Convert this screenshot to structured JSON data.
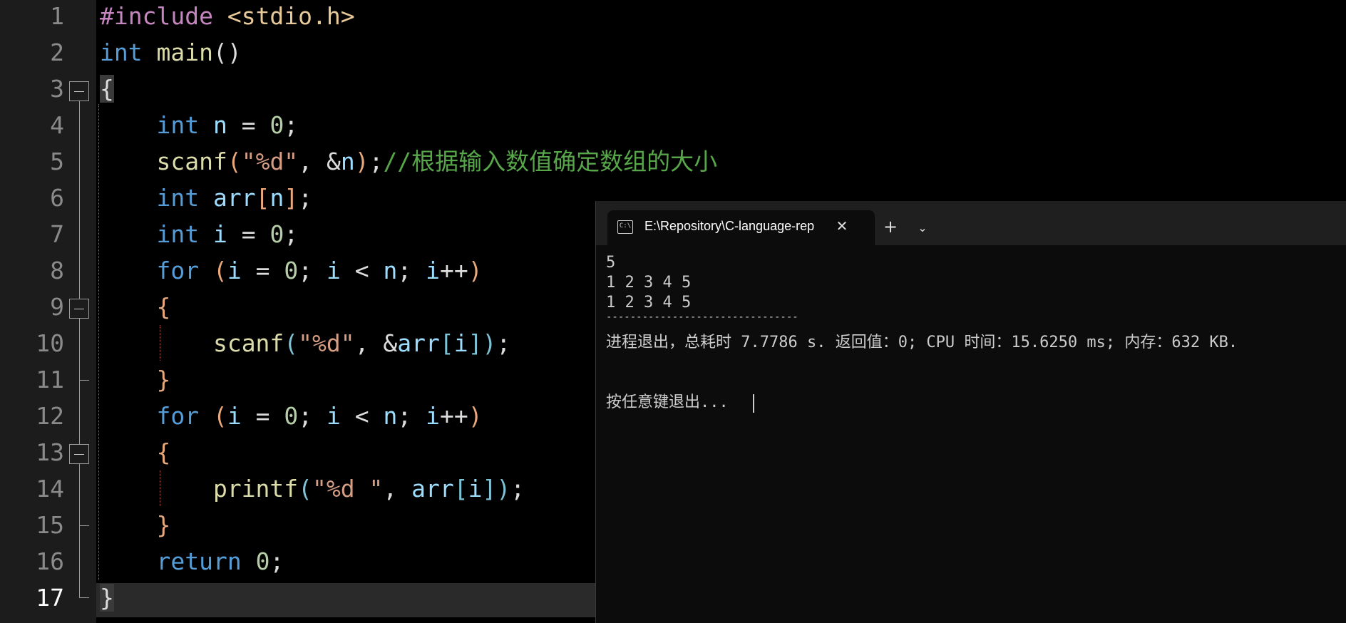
{
  "editor": {
    "line_numbers": [
      "1",
      "2",
      "3",
      "4",
      "5",
      "6",
      "7",
      "8",
      "9",
      "10",
      "11",
      "12",
      "13",
      "14",
      "15",
      "16",
      "17"
    ],
    "current_line": "17",
    "code": {
      "l1": {
        "directive": "#include",
        "header": "<stdio.h>"
      },
      "l2": {
        "kw": "int",
        "fn": "main",
        "parens": "()"
      },
      "l3": {
        "brace": "{"
      },
      "l4": {
        "kw": "int",
        "var": "n",
        "op": "=",
        "num": "0",
        "semi": ";"
      },
      "l5": {
        "fn": "scanf",
        "open": "(",
        "str": "\"%d\"",
        "comma": ",",
        "amp": "&",
        "var": "n",
        "close": ")",
        "semi": ";",
        "comment": "//根据输入数值确定数组的大小"
      },
      "l6": {
        "kw": "int",
        "var": "arr",
        "lb": "[",
        "idx": "n",
        "rb": "]",
        "semi": ";"
      },
      "l7": {
        "kw": "int",
        "var": "i",
        "op": "=",
        "num": "0",
        "semi": ";"
      },
      "l8": {
        "kw": "for",
        "open": "(",
        "v1": "i",
        "op1": "=",
        "num": "0",
        "s1": ";",
        "v2": "i",
        "op2": "<",
        "v3": "n",
        "s2": ";",
        "v4": "i",
        "inc": "++",
        "close": ")"
      },
      "l9": {
        "brace": "{"
      },
      "l10": {
        "fn": "scanf",
        "open": "(",
        "str": "\"%d\"",
        "comma": ",",
        "amp": "&",
        "var": "arr",
        "lb": "[",
        "idx": "i",
        "rb": "]",
        "close": ")",
        "semi": ";"
      },
      "l11": {
        "brace": "}"
      },
      "l12": {
        "kw": "for",
        "open": "(",
        "v1": "i",
        "op1": "=",
        "num": "0",
        "s1": ";",
        "v2": "i",
        "op2": "<",
        "v3": "n",
        "s2": ";",
        "v4": "i",
        "inc": "++",
        "close": ")"
      },
      "l13": {
        "brace": "{"
      },
      "l14": {
        "fn": "printf",
        "open": "(",
        "str": "\"%d \"",
        "comma": ",",
        "var": "arr",
        "lb": "[",
        "idx": "i",
        "rb": "]",
        "close": ")",
        "semi": ";"
      },
      "l15": {
        "brace": "}"
      },
      "l16": {
        "kw": "return",
        "num": "0",
        "semi": ";"
      },
      "l17": {
        "brace": "}"
      }
    }
  },
  "terminal": {
    "tab_title": "E:\\Repository\\C-language-rep",
    "tab_icon_text": "C:\\",
    "close_icon": "✕",
    "new_tab_icon": "+",
    "dropdown_icon": "⌄",
    "lines": [
      "5",
      "1 2 3 4 5",
      "1 2 3 4 5",
      "--------------------------------",
      "进程退出，总耗时 7.7786 s. 返回值：0; CPU 时间：15.6250 ms; 内存：632 KB.",
      "按任意键退出..."
    ]
  }
}
